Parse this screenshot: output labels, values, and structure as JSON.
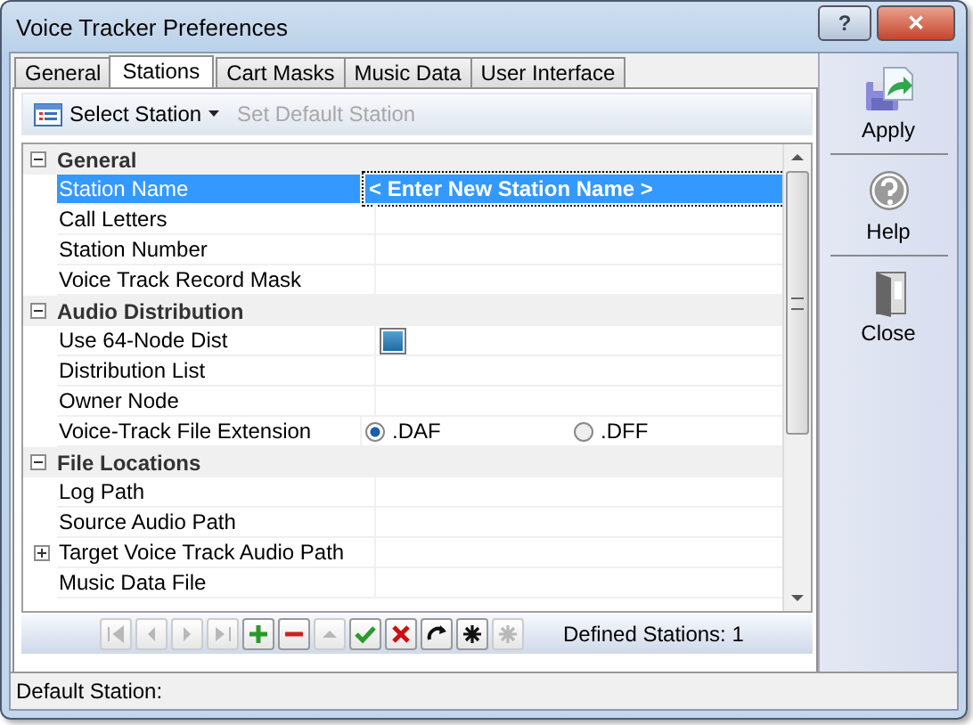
{
  "window": {
    "title": "Voice Tracker Preferences",
    "buttons": [
      {
        "kind": "help",
        "label": "?"
      },
      {
        "kind": "close",
        "label": "✕"
      }
    ]
  },
  "tabs": [
    {
      "label": "General",
      "selected": false
    },
    {
      "label": "Stations",
      "selected": true
    },
    {
      "label": "Cart Masks",
      "selected": false
    },
    {
      "label": "Music Data",
      "selected": false
    },
    {
      "label": "User Interface",
      "selected": false
    }
  ],
  "toolbar": [
    {
      "kind": "select",
      "label": "Select Station",
      "disabled": false
    },
    {
      "kind": "plain",
      "label": "Set Default Station",
      "disabled": true
    }
  ],
  "grid": {
    "categories": [
      {
        "name": "General",
        "expanded": true,
        "properties": [
          {
            "name": "Station Name",
            "kind": "text",
            "value": "< Enter New Station Name >",
            "selected": true
          },
          {
            "name": "Call Letters",
            "kind": "text",
            "selected": false
          },
          {
            "name": "Station Number",
            "kind": "text",
            "selected": false
          },
          {
            "name": "Voice Track Record Mask",
            "kind": "text",
            "selected": false
          }
        ]
      },
      {
        "name": "Audio Distribution",
        "expanded": true,
        "properties": [
          {
            "name": "Use 64-Node Dist",
            "kind": "checkbox",
            "checked": true,
            "selected": false
          },
          {
            "name": "Distribution List",
            "kind": "text",
            "selected": false
          },
          {
            "name": "Owner Node",
            "kind": "text",
            "selected": false
          },
          {
            "name": "Voice-Track File Extension",
            "kind": "radio",
            "selected": false,
            "options": [
              {
                "label": ".DAF",
                "selected": true
              },
              {
                "label": ".DFF",
                "selected": false
              }
            ]
          }
        ]
      },
      {
        "name": "File Locations",
        "expanded": true,
        "properties": [
          {
            "name": "Log Path",
            "kind": "text",
            "selected": false
          },
          {
            "name": "Source Audio Path",
            "kind": "text",
            "selected": false
          },
          {
            "name": "Target Voice Track Audio Path",
            "kind": "text",
            "selected": false,
            "expanded": false
          },
          {
            "name": "Music Data File",
            "kind": "text",
            "selected": false
          }
        ]
      }
    ]
  },
  "navigator": {
    "buttons": [
      {
        "kind": "first",
        "disabled": true
      },
      {
        "kind": "prev",
        "disabled": true
      },
      {
        "kind": "next",
        "disabled": true
      },
      {
        "kind": "last",
        "disabled": true
      },
      {
        "kind": "add",
        "disabled": false
      },
      {
        "kind": "remove",
        "disabled": false
      },
      {
        "kind": "up",
        "disabled": true
      },
      {
        "kind": "check",
        "disabled": false
      },
      {
        "kind": "cancel",
        "disabled": false
      },
      {
        "kind": "refresh",
        "disabled": false
      },
      {
        "kind": "star",
        "disabled": false
      },
      {
        "kind": "star",
        "disabled": true
      }
    ],
    "count": "Defined Stations: 1"
  },
  "side_buttons": [
    {
      "kind": "apply",
      "label": "Apply"
    },
    {
      "kind": "help",
      "label": "Help"
    },
    {
      "kind": "close",
      "label": "Close"
    }
  ],
  "status_bar": "Default Station:"
}
